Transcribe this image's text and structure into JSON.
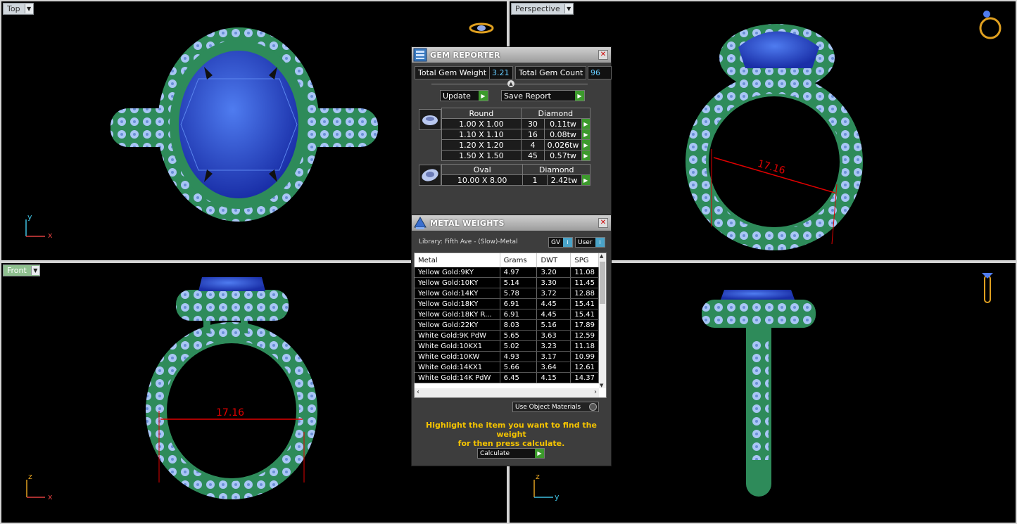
{
  "viewports": {
    "top": {
      "label": "Top"
    },
    "perspective": {
      "label": "Perspective"
    },
    "front": {
      "label": "Front"
    },
    "axes": {
      "x": "x",
      "y": "y",
      "z": "z"
    },
    "dimension": "17.16"
  },
  "gem_reporter": {
    "title": "GEM REPORTER",
    "total_weight_label": "Total Gem Weight",
    "total_weight": "3.21",
    "total_count_label": "Total Gem Count",
    "total_count": "96",
    "update_label": "Update",
    "save_label": "Save Report",
    "groups": [
      {
        "shape": "Round",
        "material": "Diamond",
        "rows": [
          {
            "size": "1.00 X 1.00",
            "count": "30",
            "weight": "0.11tw"
          },
          {
            "size": "1.10 X 1.10",
            "count": "16",
            "weight": "0.08tw"
          },
          {
            "size": "1.20 X 1.20",
            "count": "4",
            "weight": "0.026tw"
          },
          {
            "size": "1.50 X 1.50",
            "count": "45",
            "weight": "0.57tw"
          }
        ]
      },
      {
        "shape": "Oval",
        "material": "Diamond",
        "rows": [
          {
            "size": "10.00 X 8.00",
            "count": "1",
            "weight": "2.42tw"
          }
        ]
      }
    ]
  },
  "metal_weights": {
    "title": "METAL WEIGHTS",
    "library": "Library: Fifth Ave - (Slow)-Metal",
    "gv_label": "GV",
    "user_label": "User",
    "columns": [
      "Metal",
      "Grams",
      "DWT",
      "SPG"
    ],
    "rows": [
      [
        "Yellow Gold:9KY",
        "4.97",
        "3.20",
        "11.08"
      ],
      [
        "Yellow Gold:10KY",
        "5.14",
        "3.30",
        "11.45"
      ],
      [
        "Yellow Gold:14KY",
        "5.78",
        "3.72",
        "12.88"
      ],
      [
        "Yellow Gold:18KY",
        "6.91",
        "4.45",
        "15.41"
      ],
      [
        "Yellow Gold:18KY R...",
        "6.91",
        "4.45",
        "15.41"
      ],
      [
        "Yellow Gold:22KY",
        "8.03",
        "5.16",
        "17.89"
      ],
      [
        "White Gold:9K PdW",
        "5.65",
        "3.63",
        "12.59"
      ],
      [
        "White Gold:10KX1",
        "5.02",
        "3.23",
        "11.18"
      ],
      [
        "White Gold:10KW",
        "4.93",
        "3.17",
        "10.99"
      ],
      [
        "White Gold:14KX1",
        "5.66",
        "3.64",
        "12.61"
      ],
      [
        "White Gold:14K PdW",
        "6.45",
        "4.15",
        "14.37"
      ]
    ],
    "use_object_materials": "Use Object Materials",
    "instruction_line1": "Highlight the item you want to find the weight",
    "instruction_line2": "for then press calculate.",
    "calculate_label": "Calculate"
  },
  "colors": {
    "metal": "#2e8b5a",
    "stone": "#2f56d8",
    "pave": "#a9c6f5",
    "dimension": "#e00000"
  }
}
